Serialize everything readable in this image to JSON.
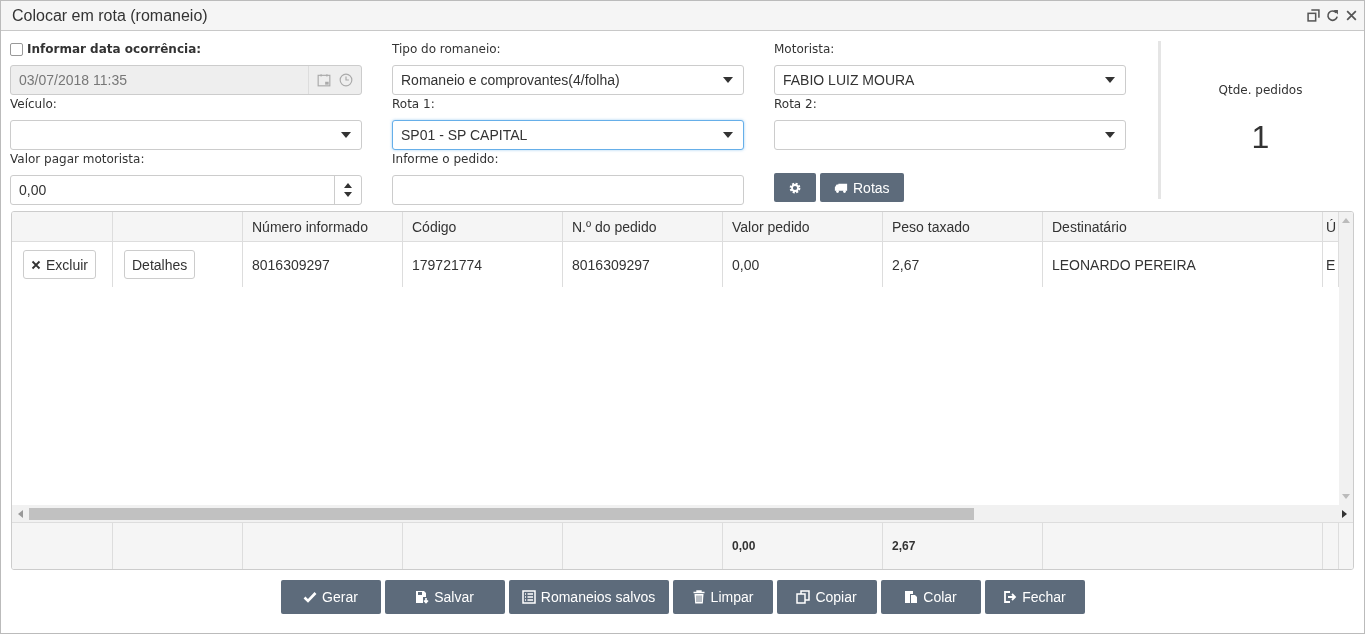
{
  "window": {
    "title": "Colocar em rota (romaneio)"
  },
  "form": {
    "fields": [
      {
        "kind": "datetime",
        "label": "Informar data ocorrência:",
        "checked": false,
        "value": "03/07/2018 11:35",
        "disabled": true
      },
      {
        "kind": "select",
        "label": "Tipo do romaneio:",
        "value": "Romaneio e comprovantes(4/folha)",
        "focused": false
      },
      {
        "kind": "select",
        "label": "Motorista:",
        "value": "FABIO LUIZ MOURA",
        "focused": false
      },
      {
        "kind": "select",
        "label": "Veículo:",
        "focused": false
      },
      {
        "kind": "select",
        "label": "Rota 1:",
        "value": "SP01 - SP CAPITAL",
        "focused": true
      },
      {
        "kind": "select",
        "label": "Rota 2:",
        "focused": false
      },
      {
        "kind": "number",
        "label": "Valor pagar motorista:",
        "value": "0,00",
        "focused": false
      },
      {
        "kind": "text",
        "label": "Informe o pedido:",
        "focused": false
      }
    ],
    "tool_buttons": [
      {
        "kind": "settings"
      },
      {
        "kind": "truck",
        "label": "Rotas"
      }
    ]
  },
  "summary": {
    "label": "Qtde. pedidos",
    "value": "1"
  },
  "table": {
    "columns": [
      {
        "kind": "action"
      },
      {
        "kind": "action"
      },
      {
        "kind": "text",
        "label": "Número informado"
      },
      {
        "kind": "text",
        "label": "Código"
      },
      {
        "kind": "text",
        "label": "N.º do pedido"
      },
      {
        "kind": "text",
        "label": "Valor pedido",
        "total": "0,00"
      },
      {
        "kind": "text",
        "label": "Peso taxado",
        "total": "2,67"
      },
      {
        "kind": "text",
        "label": "Destinatário"
      },
      {
        "kind": "text",
        "label": "Ú"
      }
    ],
    "rows": [
      {
        "cells": [
          {
            "kind": "delete",
            "label": "Excluir"
          },
          {
            "kind": "details",
            "label": "Detalhes"
          },
          {
            "kind": "text",
            "text": "8016309297"
          },
          {
            "kind": "text",
            "text": "179721774"
          },
          {
            "kind": "text",
            "text": "8016309297"
          },
          {
            "kind": "text",
            "text": "0,00"
          },
          {
            "kind": "text",
            "text": "2,67"
          },
          {
            "kind": "text",
            "text": "LEONARDO PEREIRA"
          },
          {
            "kind": "text",
            "text": "E"
          }
        ]
      }
    ]
  },
  "buttons": [
    {
      "kind": "check",
      "label": "Gerar"
    },
    {
      "kind": "save",
      "label": "Salvar"
    },
    {
      "kind": "list",
      "label": "Romaneios salvos"
    },
    {
      "kind": "trash",
      "label": "Limpar"
    },
    {
      "kind": "copy",
      "label": "Copiar"
    },
    {
      "kind": "paste",
      "label": "Colar"
    },
    {
      "kind": "exit",
      "label": "Fechar"
    }
  ]
}
